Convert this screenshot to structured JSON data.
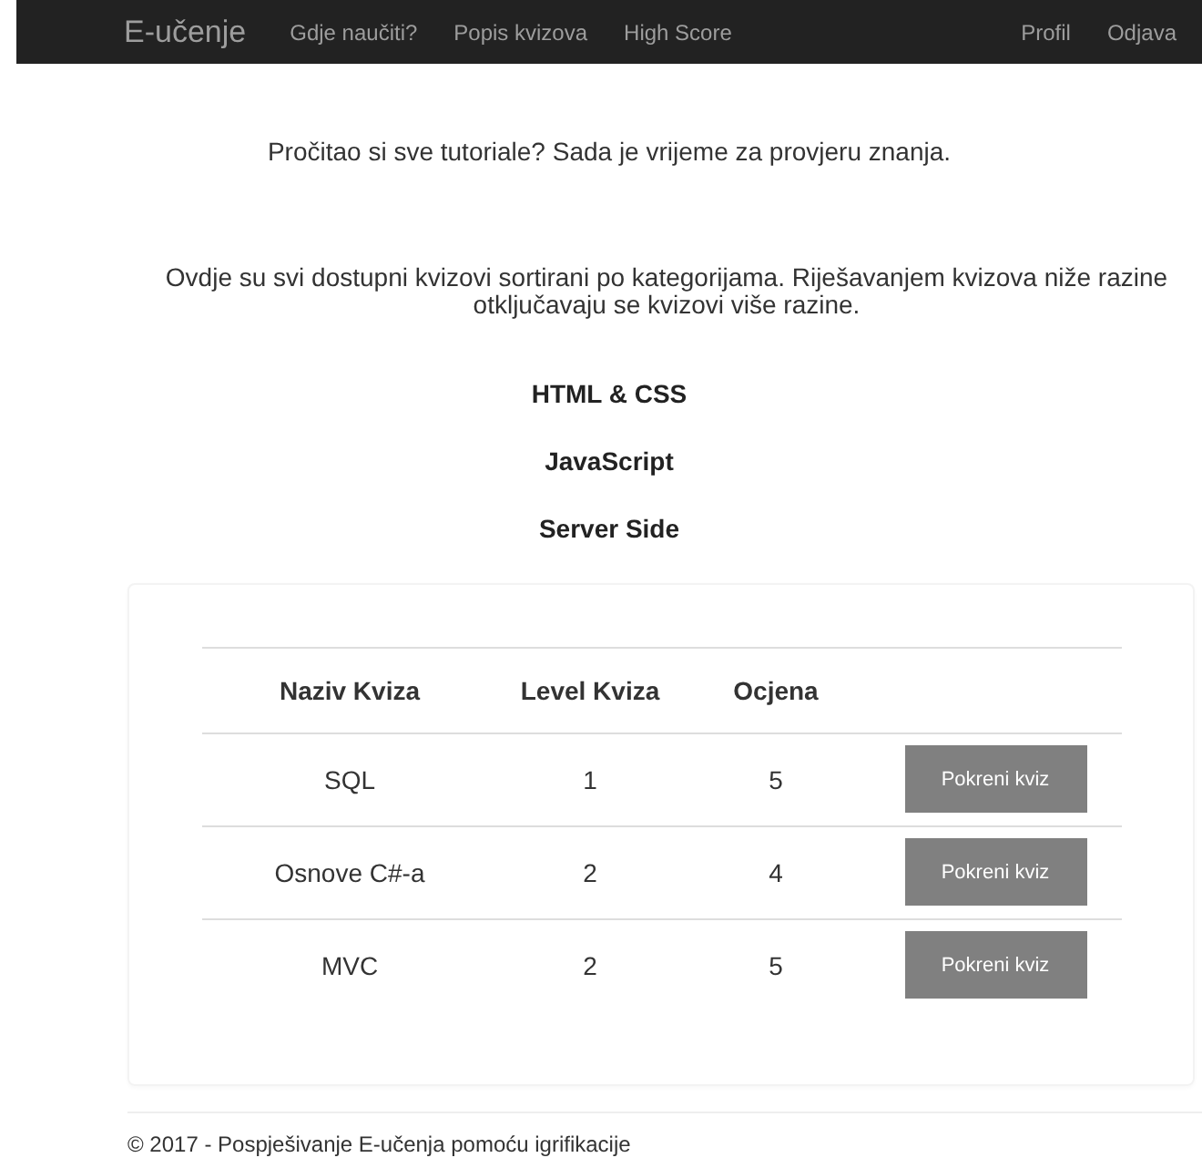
{
  "navbar": {
    "brand": "E-učenje",
    "left_links": [
      "Gdje naučiti?",
      "Popis kvizova",
      "High Score"
    ],
    "right_links": [
      "Profil",
      "Odjava"
    ]
  },
  "intro": "Pročitao si sve tutoriale? Sada je vrijeme za provjeru znanja.",
  "description": "Ovdje su svi dostupni kvizovi sortirani po kategorijama. Riješavanjem kvizova niže razine otključavaju se kvizovi više razine.",
  "categories": [
    "HTML & CSS",
    "JavaScript",
    "Server Side"
  ],
  "table": {
    "columns": [
      "Naziv Kviza",
      "Level Kviza",
      "Ocjena"
    ],
    "rows": [
      {
        "name": "SQL",
        "level": "1",
        "rating": "5",
        "action": "Pokreni kviz"
      },
      {
        "name": "Osnove C#-a",
        "level": "2",
        "rating": "4",
        "action": "Pokreni kviz"
      },
      {
        "name": "MVC",
        "level": "2",
        "rating": "5",
        "action": "Pokreni kviz"
      }
    ]
  },
  "footer": "© 2017 - Pospješivanje E-učenja pomoću igrifikacije"
}
